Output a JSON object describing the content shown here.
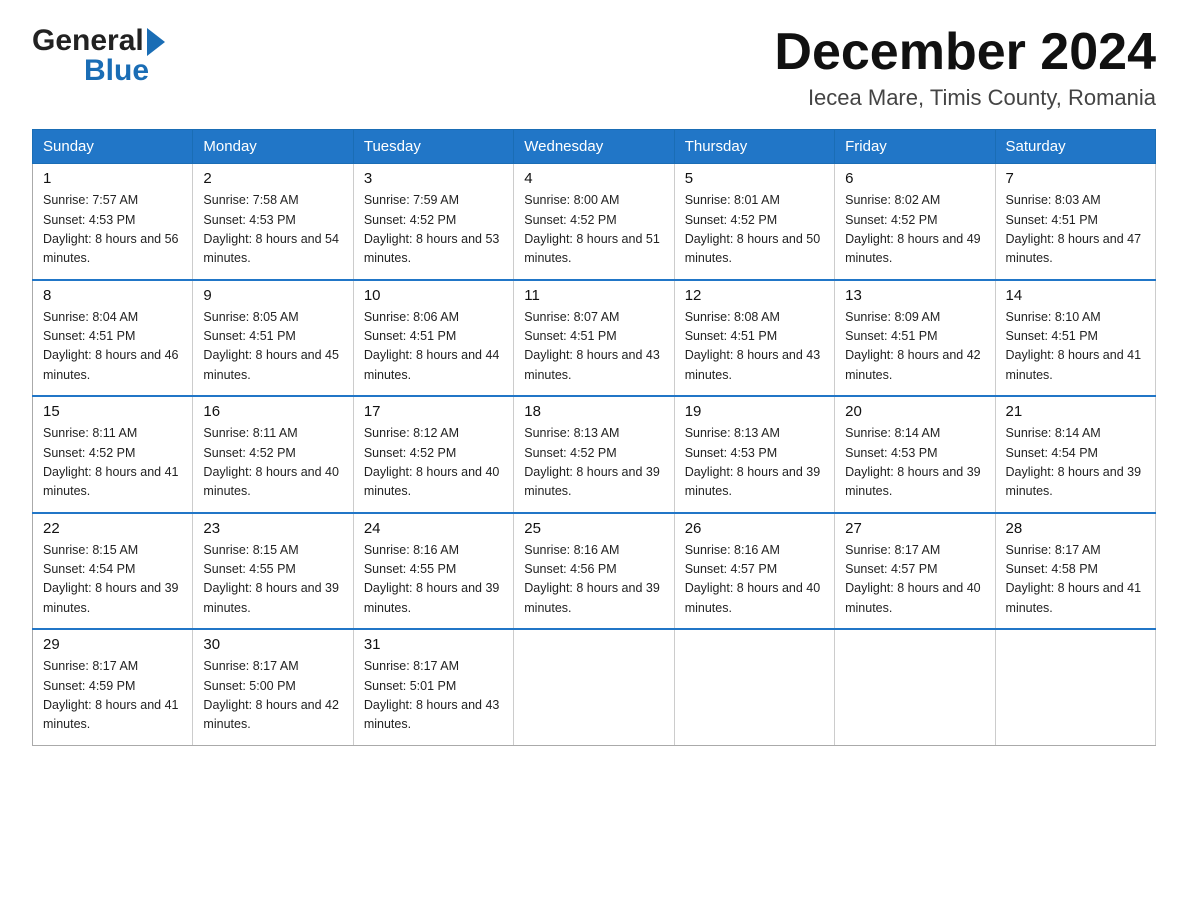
{
  "header": {
    "logo_general": "General",
    "logo_blue": "Blue",
    "month_year": "December 2024",
    "location": "Iecea Mare, Timis County, Romania"
  },
  "weekdays": [
    "Sunday",
    "Monday",
    "Tuesday",
    "Wednesday",
    "Thursday",
    "Friday",
    "Saturday"
  ],
  "weeks": [
    [
      {
        "day": "1",
        "sunrise": "7:57 AM",
        "sunset": "4:53 PM",
        "daylight": "8 hours and 56 minutes."
      },
      {
        "day": "2",
        "sunrise": "7:58 AM",
        "sunset": "4:53 PM",
        "daylight": "8 hours and 54 minutes."
      },
      {
        "day": "3",
        "sunrise": "7:59 AM",
        "sunset": "4:52 PM",
        "daylight": "8 hours and 53 minutes."
      },
      {
        "day": "4",
        "sunrise": "8:00 AM",
        "sunset": "4:52 PM",
        "daylight": "8 hours and 51 minutes."
      },
      {
        "day": "5",
        "sunrise": "8:01 AM",
        "sunset": "4:52 PM",
        "daylight": "8 hours and 50 minutes."
      },
      {
        "day": "6",
        "sunrise": "8:02 AM",
        "sunset": "4:52 PM",
        "daylight": "8 hours and 49 minutes."
      },
      {
        "day": "7",
        "sunrise": "8:03 AM",
        "sunset": "4:51 PM",
        "daylight": "8 hours and 47 minutes."
      }
    ],
    [
      {
        "day": "8",
        "sunrise": "8:04 AM",
        "sunset": "4:51 PM",
        "daylight": "8 hours and 46 minutes."
      },
      {
        "day": "9",
        "sunrise": "8:05 AM",
        "sunset": "4:51 PM",
        "daylight": "8 hours and 45 minutes."
      },
      {
        "day": "10",
        "sunrise": "8:06 AM",
        "sunset": "4:51 PM",
        "daylight": "8 hours and 44 minutes."
      },
      {
        "day": "11",
        "sunrise": "8:07 AM",
        "sunset": "4:51 PM",
        "daylight": "8 hours and 43 minutes."
      },
      {
        "day": "12",
        "sunrise": "8:08 AM",
        "sunset": "4:51 PM",
        "daylight": "8 hours and 43 minutes."
      },
      {
        "day": "13",
        "sunrise": "8:09 AM",
        "sunset": "4:51 PM",
        "daylight": "8 hours and 42 minutes."
      },
      {
        "day": "14",
        "sunrise": "8:10 AM",
        "sunset": "4:51 PM",
        "daylight": "8 hours and 41 minutes."
      }
    ],
    [
      {
        "day": "15",
        "sunrise": "8:11 AM",
        "sunset": "4:52 PM",
        "daylight": "8 hours and 41 minutes."
      },
      {
        "day": "16",
        "sunrise": "8:11 AM",
        "sunset": "4:52 PM",
        "daylight": "8 hours and 40 minutes."
      },
      {
        "day": "17",
        "sunrise": "8:12 AM",
        "sunset": "4:52 PM",
        "daylight": "8 hours and 40 minutes."
      },
      {
        "day": "18",
        "sunrise": "8:13 AM",
        "sunset": "4:52 PM",
        "daylight": "8 hours and 39 minutes."
      },
      {
        "day": "19",
        "sunrise": "8:13 AM",
        "sunset": "4:53 PM",
        "daylight": "8 hours and 39 minutes."
      },
      {
        "day": "20",
        "sunrise": "8:14 AM",
        "sunset": "4:53 PM",
        "daylight": "8 hours and 39 minutes."
      },
      {
        "day": "21",
        "sunrise": "8:14 AM",
        "sunset": "4:54 PM",
        "daylight": "8 hours and 39 minutes."
      }
    ],
    [
      {
        "day": "22",
        "sunrise": "8:15 AM",
        "sunset": "4:54 PM",
        "daylight": "8 hours and 39 minutes."
      },
      {
        "day": "23",
        "sunrise": "8:15 AM",
        "sunset": "4:55 PM",
        "daylight": "8 hours and 39 minutes."
      },
      {
        "day": "24",
        "sunrise": "8:16 AM",
        "sunset": "4:55 PM",
        "daylight": "8 hours and 39 minutes."
      },
      {
        "day": "25",
        "sunrise": "8:16 AM",
        "sunset": "4:56 PM",
        "daylight": "8 hours and 39 minutes."
      },
      {
        "day": "26",
        "sunrise": "8:16 AM",
        "sunset": "4:57 PM",
        "daylight": "8 hours and 40 minutes."
      },
      {
        "day": "27",
        "sunrise": "8:17 AM",
        "sunset": "4:57 PM",
        "daylight": "8 hours and 40 minutes."
      },
      {
        "day": "28",
        "sunrise": "8:17 AM",
        "sunset": "4:58 PM",
        "daylight": "8 hours and 41 minutes."
      }
    ],
    [
      {
        "day": "29",
        "sunrise": "8:17 AM",
        "sunset": "4:59 PM",
        "daylight": "8 hours and 41 minutes."
      },
      {
        "day": "30",
        "sunrise": "8:17 AM",
        "sunset": "5:00 PM",
        "daylight": "8 hours and 42 minutes."
      },
      {
        "day": "31",
        "sunrise": "8:17 AM",
        "sunset": "5:01 PM",
        "daylight": "8 hours and 43 minutes."
      },
      null,
      null,
      null,
      null
    ]
  ],
  "labels": {
    "sunrise": "Sunrise:",
    "sunset": "Sunset:",
    "daylight": "Daylight:"
  },
  "colors": {
    "header_bg": "#2176c7",
    "border_accent": "#2176c7"
  }
}
